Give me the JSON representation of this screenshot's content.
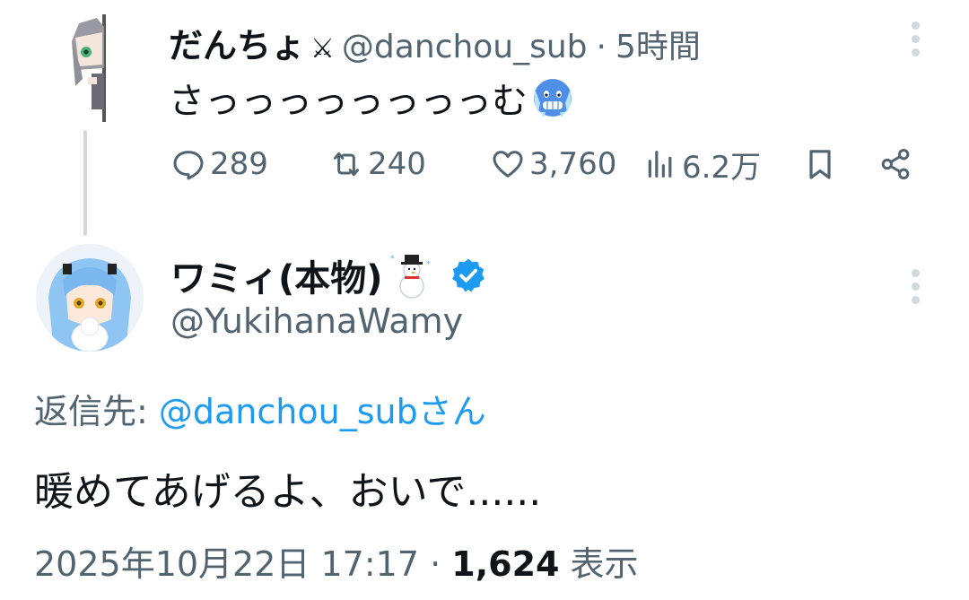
{
  "tweet1": {
    "name": "だんちょ",
    "name_badge": "⚔",
    "handle": "@danchou_sub",
    "separator": "·",
    "time": "5時間",
    "text": "さっっっっっっっっむ",
    "emoji": "cold-face-emoji",
    "replies": "289",
    "retweets": "240",
    "likes": "3,760",
    "views": "6.2万"
  },
  "tweet2": {
    "name": "ワミィ(本物)",
    "name_emoji": "snowman-emoji",
    "handle": "@YukihanaWamy",
    "reply_prefix": "返信先: ",
    "reply_mention": "@danchou_subさん",
    "text": "暖めてあげるよ、おいで......",
    "timestamp": "2025年10月22日 17:17",
    "meta_separator": " · ",
    "view_count": "1,624",
    "view_label": " 表示"
  },
  "colors": {
    "text": "#0f1419",
    "secondary": "#536471",
    "link": "#1d9bf0",
    "verified": "#1d9bf0",
    "thread_line": "#cfd9de"
  }
}
